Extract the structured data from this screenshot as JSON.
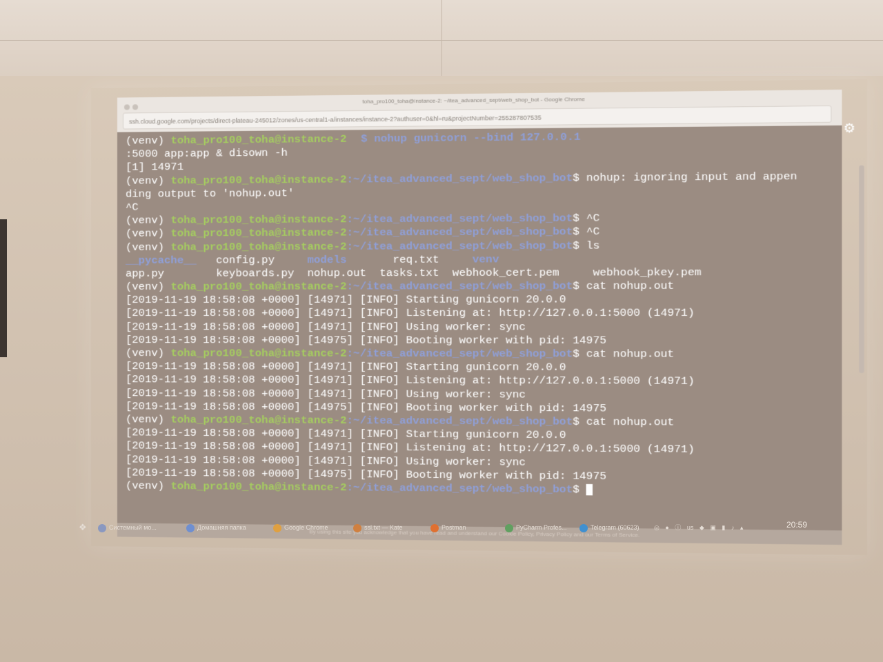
{
  "browser": {
    "window_title": "toha_pro100_toha@instance-2: ~/itea_advanced_sept/web_shop_bot - Google Chrome",
    "url": "ssh.cloud.google.com/projects/direct-plateau-245012/zones/us-central1-a/instances/instance-2?authuser=0&hl=ru&projectNumber=255287807535"
  },
  "terminal": {
    "lines": [
      [
        {
          "t": "(venv) ",
          "c": "plain"
        },
        {
          "t": "toha_pro100_toha@instance-2",
          "c": "user"
        }
      ],
      [
        {
          "t": ":5000 app:app & disown -h",
          "c": "plain"
        }
      ],
      [
        {
          "t": "[1] 14971",
          "c": "plain"
        }
      ],
      [
        {
          "t": "(venv) ",
          "c": "plain"
        },
        {
          "t": "toha_pro100_toha@instance-2",
          "c": "user"
        },
        {
          "t": ":~/itea_advanced_sept/web_shop_bot",
          "c": "path"
        },
        {
          "t": "$ nohup: ignoring input and appen",
          "c": "plain"
        }
      ],
      [
        {
          "t": "ding output to 'nohup.out'",
          "c": "plain"
        }
      ],
      [
        {
          "t": "^C",
          "c": "plain"
        }
      ],
      [
        {
          "t": "(venv) ",
          "c": "plain"
        },
        {
          "t": "toha_pro100_toha@instance-2",
          "c": "user"
        },
        {
          "t": ":~/itea_advanced_sept/web_shop_bot",
          "c": "path"
        },
        {
          "t": "$ ^C",
          "c": "plain"
        }
      ],
      [
        {
          "t": "(venv) ",
          "c": "plain"
        },
        {
          "t": "toha_pro100_toha@instance-2",
          "c": "user"
        },
        {
          "t": ":~/itea_advanced_sept/web_shop_bot",
          "c": "path"
        },
        {
          "t": "$ ^C",
          "c": "plain"
        }
      ],
      [
        {
          "t": "(venv) ",
          "c": "plain"
        },
        {
          "t": "toha_pro100_toha@instance-2",
          "c": "user"
        },
        {
          "t": ":~/itea_advanced_sept/web_shop_bot",
          "c": "path"
        },
        {
          "t": "$ ls",
          "c": "plain"
        }
      ],
      [
        {
          "t": "__pycache__",
          "c": "dir"
        },
        {
          "t": "   config.py     ",
          "c": "plain"
        },
        {
          "t": "models",
          "c": "dir"
        },
        {
          "t": "       req.txt     ",
          "c": "plain"
        },
        {
          "t": "venv",
          "c": "dir"
        }
      ],
      [
        {
          "t": "app.py        keyboards.py  nohup.out  tasks.txt  webhook_cert.pem     webhook_pkey.pem",
          "c": "plain"
        }
      ],
      [
        {
          "t": "(venv) ",
          "c": "plain"
        },
        {
          "t": "toha_pro100_toha@instance-2",
          "c": "user"
        },
        {
          "t": ":~/itea_advanced_sept/web_shop_bot",
          "c": "path"
        },
        {
          "t": "$ cat nohup.out",
          "c": "plain"
        }
      ],
      [
        {
          "t": "[2019-11-19 18:58:08 +0000] [14971] [INFO] Starting gunicorn 20.0.0",
          "c": "plain"
        }
      ],
      [
        {
          "t": "[2019-11-19 18:58:08 +0000] [14971] [INFO] Listening at: http://127.0.0.1:5000 (14971)",
          "c": "plain"
        }
      ],
      [
        {
          "t": "[2019-11-19 18:58:08 +0000] [14971] [INFO] Using worker: sync",
          "c": "plain"
        }
      ],
      [
        {
          "t": "[2019-11-19 18:58:08 +0000] [14975] [INFO] Booting worker with pid: 14975",
          "c": "plain"
        }
      ],
      [
        {
          "t": "(venv) ",
          "c": "plain"
        },
        {
          "t": "toha_pro100_toha@instance-2",
          "c": "user"
        },
        {
          "t": ":~/itea_advanced_sept/web_shop_bot",
          "c": "path"
        },
        {
          "t": "$ cat nohup.out",
          "c": "plain"
        }
      ],
      [
        {
          "t": "[2019-11-19 18:58:08 +0000] [14971] [INFO] Starting gunicorn 20.0.0",
          "c": "plain"
        }
      ],
      [
        {
          "t": "[2019-11-19 18:58:08 +0000] [14971] [INFO] Listening at: http://127.0.0.1:5000 (14971)",
          "c": "plain"
        }
      ],
      [
        {
          "t": "[2019-11-19 18:58:08 +0000] [14971] [INFO] Using worker: sync",
          "c": "plain"
        }
      ],
      [
        {
          "t": "[2019-11-19 18:58:08 +0000] [14975] [INFO] Booting worker with pid: 14975",
          "c": "plain"
        }
      ],
      [
        {
          "t": "(venv) ",
          "c": "plain"
        },
        {
          "t": "toha_pro100_toha@instance-2",
          "c": "user"
        },
        {
          "t": ":~/itea_advanced_sept/web_shop_bot",
          "c": "path"
        },
        {
          "t": "$ cat nohup.out",
          "c": "plain"
        }
      ],
      [
        {
          "t": "[2019-11-19 18:58:08 +0000] [14971] [INFO] Starting gunicorn 20.0.0",
          "c": "plain"
        }
      ],
      [
        {
          "t": "[2019-11-19 18:58:08 +0000] [14971] [INFO] Listening at: http://127.0.0.1:5000 (14971)",
          "c": "plain"
        }
      ],
      [
        {
          "t": "[2019-11-19 18:58:08 +0000] [14971] [INFO] Using worker: sync",
          "c": "plain"
        }
      ],
      [
        {
          "t": "[2019-11-19 18:58:08 +0000] [14975] [INFO] Booting worker with pid: 14975",
          "c": "plain"
        }
      ],
      [
        {
          "t": "(venv) ",
          "c": "plain"
        },
        {
          "t": "toha_pro100_toha@instance-2",
          "c": "user"
        },
        {
          "t": ":~/itea_advanced_sept/web_shop_bot",
          "c": "path"
        },
        {
          "t": "$ ",
          "c": "plain"
        },
        {
          "t": "",
          "c": "cursor"
        }
      ]
    ],
    "overlay_command": "$ nohup gunicorn --bind 127.0.0.1"
  },
  "cookie_notice": "By using this site you acknowledge that you have read and understand our Cookie Policy, Privacy Policy and our Terms of Service.",
  "taskbar": {
    "items": [
      {
        "label": "Системный мо...",
        "icon_color": "#8a98c0"
      },
      {
        "label": "Домашняя папка",
        "icon_color": "#6f8fd0"
      },
      {
        "label": "Google Chrome",
        "icon_color": "#e0a040"
      },
      {
        "label": "ssl.txt — Kate",
        "icon_color": "#d08040"
      },
      {
        "label": "Postman",
        "icon_color": "#e07030"
      },
      {
        "label": "PyCharm Profes...",
        "icon_color": "#60a060"
      },
      {
        "label": "Telegram (60623)",
        "icon_color": "#4090d0"
      }
    ],
    "tray_keyboard": "us",
    "clock": "20:59"
  }
}
